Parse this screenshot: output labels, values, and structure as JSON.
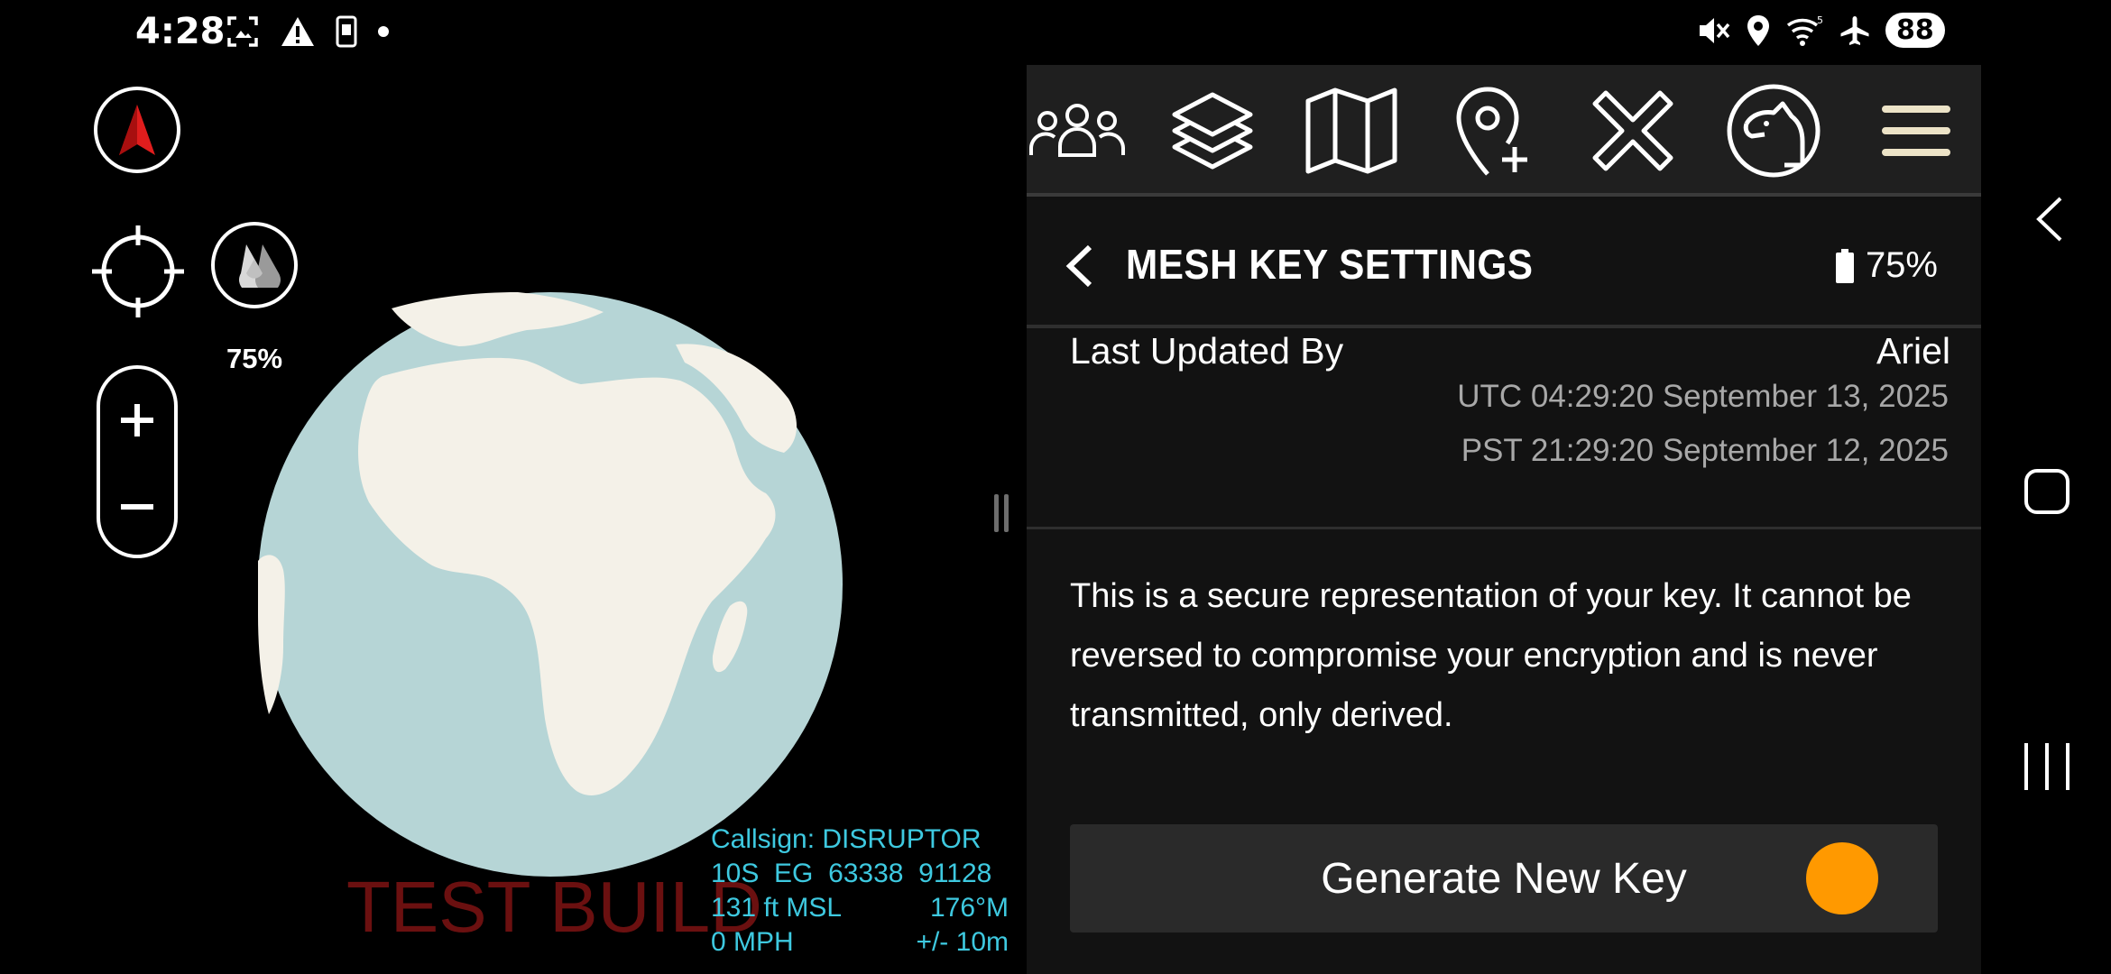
{
  "status_bar": {
    "time": "4:28",
    "left_icons": [
      "screenshot-icon",
      "warning-icon",
      "phone-icon",
      "dot-icon"
    ],
    "right_icons": [
      "mute-icon",
      "location-icon",
      "wifi-icon",
      "airplane-icon"
    ],
    "wifi_label": "5",
    "battery": "88"
  },
  "map": {
    "layer_opacity": "75%",
    "watermark": "TEST BUILD",
    "colors": {
      "ocean": "#b6d5d6",
      "land": "#f4f1e8",
      "readout": "#3ec9e0",
      "watermark": "#6b1010"
    },
    "readout": {
      "callsign": "Callsign: DISRUPTOR",
      "grid": "10S  EG  63338  91128",
      "altitude": "131 ft MSL",
      "heading": "176°M",
      "speed": "0 MPH",
      "accuracy": "+/- 10m"
    }
  },
  "toolbar": {
    "buttons": [
      "team-icon",
      "layers-icon",
      "map-icon",
      "add-pin-icon",
      "close-icon",
      "dog-icon",
      "menu-icon"
    ]
  },
  "panel": {
    "title": "MESH KEY SETTINGS",
    "battery": "75%",
    "last_updated_label": "Last Updated By",
    "last_updated_value": "Ariel",
    "utc_time": "UTC 04:29:20 September 13, 2025",
    "pst_time": "PST 21:29:20 September 12, 2025",
    "description": "This is a secure representation of your key. It cannot be reversed to compromise your encryption and is never transmitted, only derived.",
    "generate_label": "Generate New Key",
    "generate_color": "#ff9900"
  }
}
